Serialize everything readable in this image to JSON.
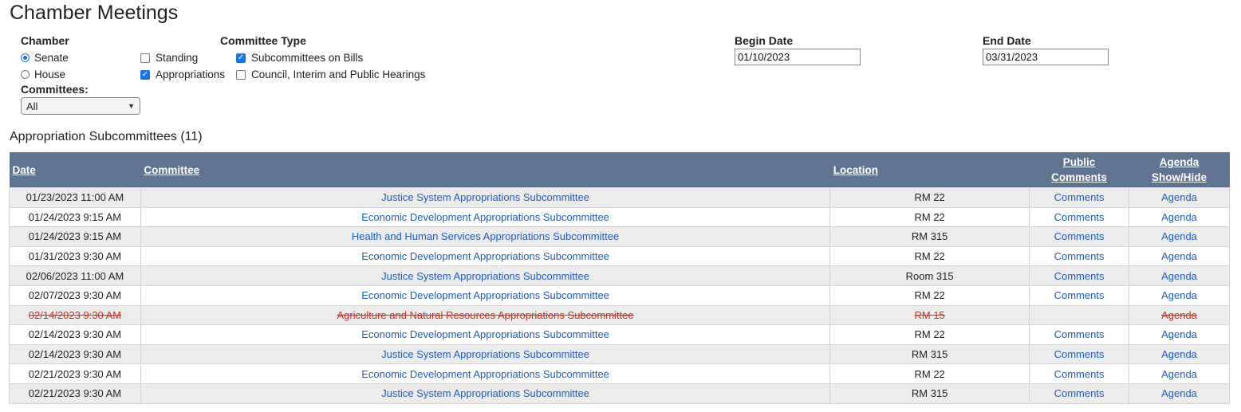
{
  "page": {
    "title": "Chamber Meetings"
  },
  "filters": {
    "chamber_label": "Chamber",
    "chamber_options": [
      {
        "label": "Senate",
        "selected": true
      },
      {
        "label": "House",
        "selected": false
      }
    ],
    "committee_type_label": "Committee Type",
    "committee_types": [
      {
        "label": "Standing",
        "checked": false
      },
      {
        "label": "Subcommittees on Bills",
        "checked": true
      },
      {
        "label": "Appropriations",
        "checked": true
      },
      {
        "label": "Council, Interim and Public Hearings",
        "checked": false
      }
    ],
    "committees_label": "Committees:",
    "committees_value": "All",
    "begin_date_label": "Begin Date",
    "begin_date_value": "01/10/2023",
    "end_date_label": "End Date",
    "end_date_value": "03/31/2023"
  },
  "section": {
    "title": "Appropriation Subcommittees (11)"
  },
  "table": {
    "headers": {
      "date": "Date",
      "committee": "Committee",
      "location": "Location",
      "public_comments_1": "Public",
      "public_comments_2": "Comments",
      "agenda_1": "Agenda",
      "agenda_2": "Show/Hide"
    },
    "rows": [
      {
        "date": "01/23/2023 11:00 AM",
        "committee": "Justice System Appropriations Subcommittee",
        "location": "RM 22",
        "comments": "Comments",
        "agenda": "Agenda",
        "cancelled": false
      },
      {
        "date": "01/24/2023 9:15 AM",
        "committee": "Economic Development Appropriations Subcommittee",
        "location": "RM 22",
        "comments": "Comments",
        "agenda": "Agenda",
        "cancelled": false
      },
      {
        "date": "01/24/2023 9:15 AM",
        "committee": "Health and Human Services Appropriations Subcommittee",
        "location": "RM 315",
        "comments": "Comments",
        "agenda": "Agenda",
        "cancelled": false
      },
      {
        "date": "01/31/2023 9:30 AM",
        "committee": "Economic Development Appropriations Subcommittee",
        "location": "RM 22",
        "comments": "Comments",
        "agenda": "Agenda",
        "cancelled": false
      },
      {
        "date": "02/06/2023 11:00 AM",
        "committee": "Justice System Appropriations Subcommittee",
        "location": "Room 315",
        "comments": "Comments",
        "agenda": "Agenda",
        "cancelled": false
      },
      {
        "date": "02/07/2023 9:30 AM",
        "committee": "Economic Development Appropriations Subcommittee",
        "location": "RM 22",
        "comments": "Comments",
        "agenda": "Agenda",
        "cancelled": false
      },
      {
        "date": "02/14/2023 9:30 AM",
        "committee": "Agriculture and Natural Resources Appropriations Subcommittee",
        "location": "RM 15",
        "comments": "",
        "agenda": "Agenda",
        "cancelled": true
      },
      {
        "date": "02/14/2023 9:30 AM",
        "committee": "Economic Development Appropriations Subcommittee",
        "location": "RM 22",
        "comments": "Comments",
        "agenda": "Agenda",
        "cancelled": false
      },
      {
        "date": "02/14/2023 9:30 AM",
        "committee": "Justice System Appropriations Subcommittee",
        "location": "RM 315",
        "comments": "Comments",
        "agenda": "Agenda",
        "cancelled": false
      },
      {
        "date": "02/21/2023 9:30 AM",
        "committee": "Economic Development Appropriations Subcommittee",
        "location": "RM 22",
        "comments": "Comments",
        "agenda": "Agenda",
        "cancelled": false
      },
      {
        "date": "02/21/2023 9:30 AM",
        "committee": "Justice System Appropriations Subcommittee",
        "location": "RM 315",
        "comments": "Comments",
        "agenda": "Agenda",
        "cancelled": false
      }
    ]
  },
  "colors": {
    "header_bg": "#5f7490",
    "link": "#1f5bbf",
    "cancelled": "#d62d20",
    "accent": "#1a73e8"
  }
}
